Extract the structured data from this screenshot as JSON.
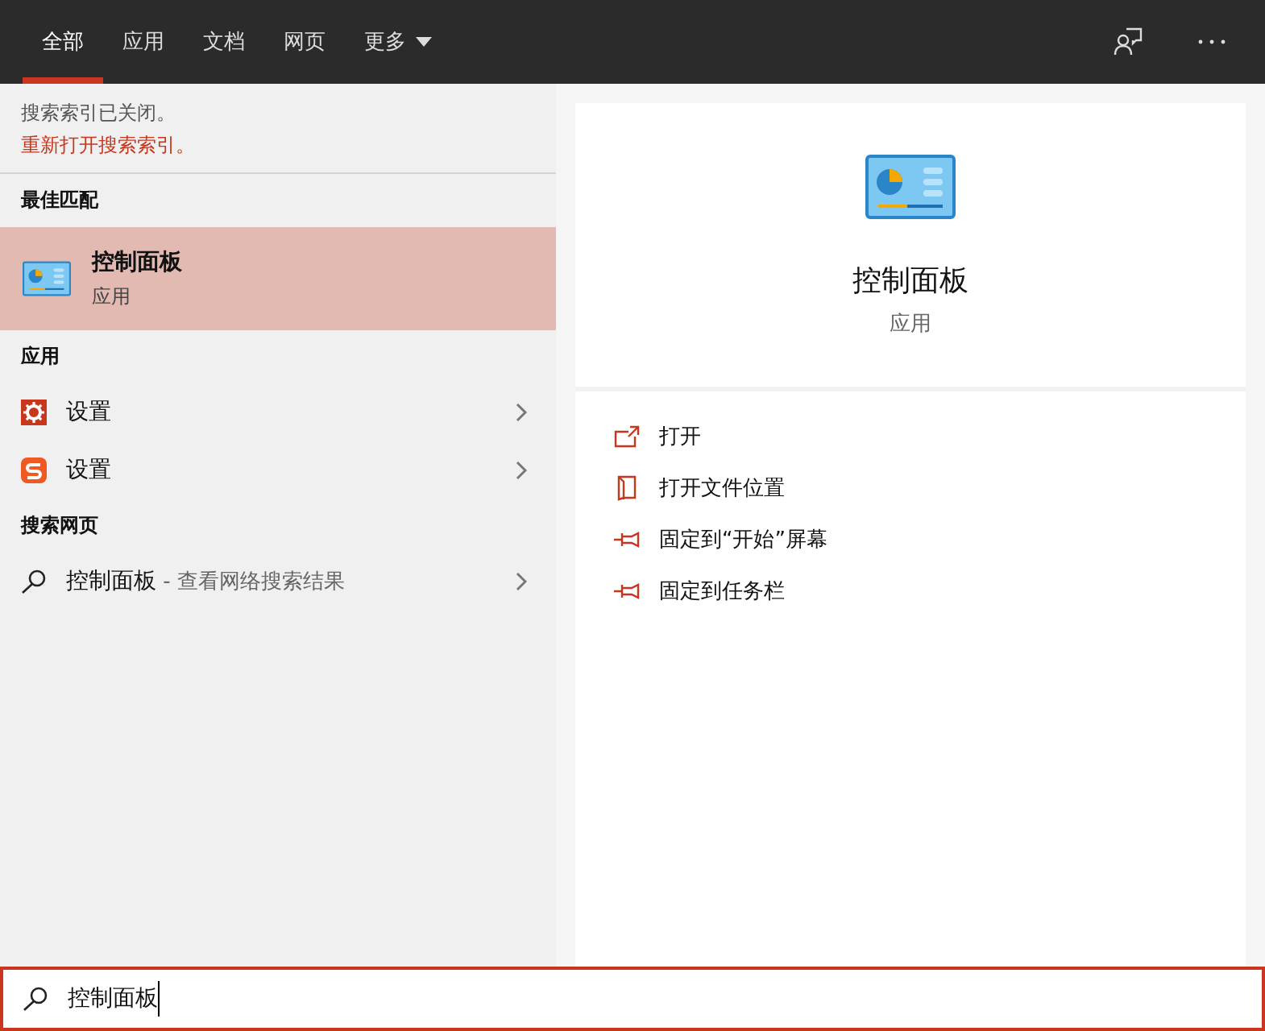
{
  "tabs": [
    {
      "label": "全部",
      "selected": true
    },
    {
      "label": "应用",
      "selected": false
    },
    {
      "label": "文档",
      "selected": false
    },
    {
      "label": "网页",
      "selected": false
    },
    {
      "label": "更多",
      "selected": false
    }
  ],
  "notice": {
    "text": "搜索索引已关闭。",
    "link": "重新打开搜索索引。"
  },
  "best_match": {
    "heading": "最佳匹配",
    "title": "控制面板",
    "subtitle": "应用",
    "selected": true
  },
  "apps": {
    "heading": "应用",
    "items": [
      {
        "label": "设置"
      },
      {
        "label": "设置"
      }
    ]
  },
  "web": {
    "heading": "搜索网页",
    "query": "控制面板",
    "hint": " - 查看网络搜索结果"
  },
  "detail": {
    "title": "控制面板",
    "subtitle": "应用",
    "actions": [
      {
        "label": "打开"
      },
      {
        "label": "打开文件位置"
      },
      {
        "label": "固定到“开始”屏幕"
      },
      {
        "label": "固定到任务栏"
      }
    ]
  },
  "search": {
    "value": "控制面板"
  }
}
